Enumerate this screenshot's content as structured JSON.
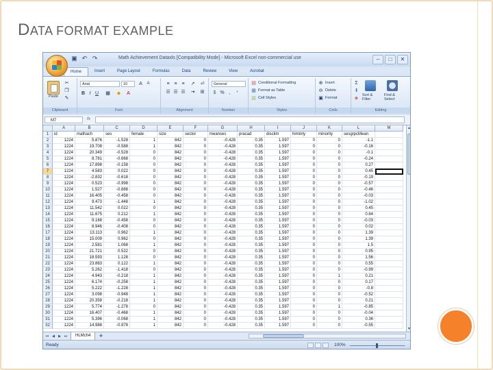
{
  "slide": {
    "title_cap": "D",
    "title_rest": "ATA FORMAT EXAMPLE"
  },
  "window": {
    "title": "Math Achievement Dataxls [Compatibility Mode] - Microsoft Excel non-commercial use"
  },
  "ribbon": {
    "tabs": [
      "Home",
      "Insert",
      "Page Layout",
      "Formulas",
      "Data",
      "Review",
      "View",
      "Acrobat"
    ],
    "clipboard": {
      "label": "Clipboard",
      "paste": "Paste"
    },
    "font": {
      "label": "Font",
      "name": "Arial",
      "size": "10"
    },
    "alignment": {
      "label": "Alignment"
    },
    "number": {
      "label": "Number",
      "format": "General",
      "pct": "%",
      "comma": ","
    },
    "styles": {
      "label": "Styles",
      "cond": "Conditional Formatting",
      "table": "Format as Table",
      "cell": "Cell Styles"
    },
    "cells": {
      "label": "Cells",
      "insert": "Insert",
      "delete": "Delete",
      "format": "Format"
    },
    "editing": {
      "label": "Editing",
      "sort": "Sort & Filter",
      "find": "Find & Select",
      "sigma": "Σ"
    }
  },
  "formula_bar": {
    "name_box": "M7",
    "fx": "fx",
    "value": ""
  },
  "columns": [
    "A",
    "B",
    "C",
    "D",
    "E",
    "F",
    "G",
    "H",
    "I",
    "J",
    "K",
    "L",
    "M"
  ],
  "rows": [
    {
      "n": "1",
      "cells": [
        "id",
        "mathach",
        "ses",
        "female",
        "size",
        "sector",
        "meanses",
        "pracad",
        "disclim",
        "himinty",
        "minority",
        "sesgrpcMean",
        ""
      ]
    },
    {
      "n": "2",
      "cells": [
        "1224",
        "5.876",
        "-1.528",
        "1",
        "842",
        "0",
        "-0.428",
        "0.35",
        "1.597",
        "0",
        "0",
        "-1.1",
        ""
      ]
    },
    {
      "n": "3",
      "cells": [
        "1224",
        "19.708",
        "-0.588",
        "1",
        "842",
        "0",
        "-0.428",
        "0.35",
        "1.597",
        "0",
        "0",
        "-0.16",
        ""
      ]
    },
    {
      "n": "4",
      "cells": [
        "1224",
        "20.349",
        "-0.528",
        "0",
        "842",
        "0",
        "-0.428",
        "0.35",
        "1.597",
        "0",
        "0",
        "-0.1",
        ""
      ]
    },
    {
      "n": "5",
      "cells": [
        "1224",
        "8.781",
        "-0.668",
        "0",
        "842",
        "0",
        "-0.428",
        "0.35",
        "1.597",
        "0",
        "0",
        "-0.24",
        ""
      ]
    },
    {
      "n": "6",
      "cells": [
        "1224",
        "17.898",
        "-0.158",
        "0",
        "842",
        "0",
        "-0.428",
        "0.35",
        "1.597",
        "0",
        "0",
        "0.27",
        ""
      ]
    },
    {
      "n": "7",
      "cells": [
        "1224",
        "4.583",
        "0.022",
        "0",
        "842",
        "0",
        "-0.428",
        "0.35",
        "1.597",
        "0",
        "0",
        "0.45",
        ""
      ]
    },
    {
      "n": "8",
      "cells": [
        "1224",
        "-2.832",
        "-0.618",
        "0",
        "842",
        "0",
        "-0.428",
        "0.35",
        "1.597",
        "0",
        "0",
        "-0.19",
        ""
      ]
    },
    {
      "n": "9",
      "cells": [
        "1224",
        "0.523",
        "-0.998",
        "0",
        "842",
        "0",
        "-0.428",
        "0.35",
        "1.597",
        "0",
        "0",
        "-0.57",
        ""
      ]
    },
    {
      "n": "10",
      "cells": [
        "1224",
        "1.527",
        "-0.888",
        "0",
        "842",
        "0",
        "-0.428",
        "0.35",
        "1.597",
        "0",
        "0",
        "-0.46",
        ""
      ]
    },
    {
      "n": "11",
      "cells": [
        "1224",
        "16.405",
        "-0.458",
        "0",
        "842",
        "0",
        "-0.428",
        "0.35",
        "1.597",
        "0",
        "0",
        "-0.03",
        ""
      ]
    },
    {
      "n": "12",
      "cells": [
        "1224",
        "9.473",
        "-1.448",
        "1",
        "842",
        "0",
        "-0.428",
        "0.35",
        "1.597",
        "0",
        "0",
        "-1.02",
        ""
      ]
    },
    {
      "n": "13",
      "cells": [
        "1224",
        "11.542",
        "0.022",
        "0",
        "842",
        "0",
        "-0.428",
        "0.35",
        "1.597",
        "0",
        "0",
        "0.45",
        ""
      ]
    },
    {
      "n": "14",
      "cells": [
        "1224",
        "11.675",
        "0.212",
        "1",
        "842",
        "0",
        "-0.428",
        "0.35",
        "1.597",
        "0",
        "0",
        "0.64",
        ""
      ]
    },
    {
      "n": "15",
      "cells": [
        "1224",
        "9.168",
        "-0.458",
        "0",
        "842",
        "0",
        "-0.428",
        "0.35",
        "1.597",
        "0",
        "0",
        "-0.03",
        ""
      ]
    },
    {
      "n": "16",
      "cells": [
        "1224",
        "8.946",
        "-0.408",
        "0",
        "842",
        "0",
        "-0.428",
        "0.35",
        "1.597",
        "0",
        "0",
        "0.02",
        ""
      ]
    },
    {
      "n": "17",
      "cells": [
        "1224",
        "13.113",
        "0.962",
        "1",
        "842",
        "0",
        "-0.428",
        "0.35",
        "1.597",
        "0",
        "0",
        "1.39",
        ""
      ]
    },
    {
      "n": "18",
      "cells": [
        "1224",
        "15.009",
        "0.962",
        "0",
        "842",
        "0",
        "-0.428",
        "0.35",
        "1.597",
        "0",
        "0",
        "1.39",
        ""
      ]
    },
    {
      "n": "19",
      "cells": [
        "1224",
        "2.581",
        "1.068",
        "1",
        "842",
        "0",
        "-0.428",
        "0.35",
        "1.597",
        "0",
        "0",
        "1.5",
        ""
      ]
    },
    {
      "n": "20",
      "cells": [
        "1224",
        "21.721",
        "0.522",
        "0",
        "842",
        "0",
        "-0.428",
        "0.35",
        "1.597",
        "0",
        "0",
        "0.95",
        ""
      ]
    },
    {
      "n": "21",
      "cells": [
        "1224",
        "18.593",
        "1.128",
        "0",
        "842",
        "0",
        "-0.428",
        "0.35",
        "1.597",
        "0",
        "0",
        "1.56",
        ""
      ]
    },
    {
      "n": "22",
      "cells": [
        "1224",
        "23.863",
        "0.122",
        "1",
        "842",
        "0",
        "-0.428",
        "0.35",
        "1.597",
        "0",
        "0",
        "0.55",
        ""
      ]
    },
    {
      "n": "23",
      "cells": [
        "1224",
        "5.262",
        "-1.418",
        "0",
        "842",
        "0",
        "-0.428",
        "0.35",
        "1.597",
        "0",
        "0",
        "-0.99",
        ""
      ]
    },
    {
      "n": "24",
      "cells": [
        "1224",
        "4.943",
        "-0.218",
        "1",
        "842",
        "0",
        "-0.428",
        "0.35",
        "1.597",
        "0",
        "1",
        "0.21",
        ""
      ]
    },
    {
      "n": "25",
      "cells": [
        "1224",
        "6.174",
        "-0.258",
        "1",
        "842",
        "0",
        "-0.428",
        "0.35",
        "1.597",
        "0",
        "0",
        "0.17",
        ""
      ]
    },
    {
      "n": "26",
      "cells": [
        "1224",
        "5.222",
        "-1.228",
        "1",
        "842",
        "0",
        "-0.428",
        "0.35",
        "1.597",
        "0",
        "0",
        "-0.8",
        ""
      ]
    },
    {
      "n": "27",
      "cells": [
        "1224",
        "3.098",
        "-0.948",
        "1",
        "842",
        "0",
        "-0.428",
        "0.35",
        "1.597",
        "0",
        "0",
        "-0.52",
        ""
      ]
    },
    {
      "n": "28",
      "cells": [
        "1224",
        "20.358",
        "-0.218",
        "1",
        "842",
        "0",
        "-0.428",
        "0.35",
        "1.597",
        "0",
        "0",
        "0.21",
        ""
      ]
    },
    {
      "n": "29",
      "cells": [
        "1224",
        "5.774",
        "-1.278",
        "0",
        "842",
        "0",
        "-0.428",
        "0.35",
        "1.597",
        "0",
        "1",
        "-0.85",
        ""
      ]
    },
    {
      "n": "30",
      "cells": [
        "1224",
        "16.407",
        "-0.468",
        "1",
        "842",
        "0",
        "-0.428",
        "0.35",
        "1.597",
        "0",
        "0",
        "-0.04",
        ""
      ]
    },
    {
      "n": "31",
      "cells": [
        "1224",
        "5.396",
        "-0.068",
        "1",
        "842",
        "0",
        "-0.428",
        "0.35",
        "1.597",
        "0",
        "0",
        "0.36",
        ""
      ]
    },
    {
      "n": "32",
      "cells": [
        "1224",
        "14.988",
        "-0.978",
        "1",
        "842",
        "0",
        "-0.428",
        "0.35",
        "1.597",
        "0",
        "0",
        "-0.55",
        ""
      ]
    }
  ],
  "sheet_tabs": [
    "HLMch4"
  ],
  "status": {
    "text": "Ready",
    "zoom": "100%"
  },
  "colors": {
    "accent": "#f5812b",
    "frame": "#f3d9b8",
    "title_text": "#5f5f5f"
  }
}
